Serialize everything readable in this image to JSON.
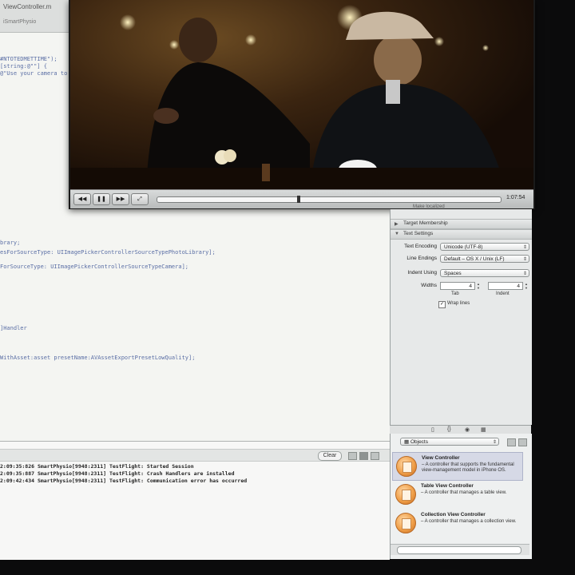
{
  "editor": {
    "tab_title": "ViewController.m",
    "tab_subtitle": "iSmartPhysio",
    "code_lines": [
      "#NTOTEDMETTIME\");",
      "[string:@\"\"] {",
      "@\"Use your camera to",
      "brary;",
      "esForSourceType: UIImagePickerControllerSourceTypePhotoLibrary];",
      "ForSourceType: UIImagePickerControllerSourceTypeCamera];",
      "]Handler",
      "WithAsset:asset presetName:AVAssetExportPresetLowQuality];"
    ]
  },
  "console": {
    "clear_label": "Clear",
    "log_lines": [
      "2:09:35:826 SmartPhysio[9948:2311] TestFlight: Started Session",
      "2:09:35:887 SmartPhysio[9948:2311] TestFlight: Crash Handlers are installed",
      "2:09:42:434 SmartPhysio[9948:2311] TestFlight: Communication error has occurred"
    ]
  },
  "video": {
    "rewind_icon": "rewind-icon",
    "play_icon": "pause-icon",
    "ffwd_icon": "fast-forward-icon",
    "fullscreen_icon": "fullscreen-icon",
    "time": "1:07:54",
    "progress": 0.41
  },
  "inspector": {
    "cropped_header": "Make localized",
    "target_membership": "Target Membership",
    "text_settings": "Text Settings",
    "text_encoding_label": "Text Encoding",
    "text_encoding_value": "Unicode (UTF-8)",
    "line_endings_label": "Line Endings",
    "line_endings_value": "Default – OS X / Unix (LF)",
    "indent_using_label": "Indent Using",
    "indent_using_value": "Spaces",
    "widths_label": "Widths",
    "tab_width": "4",
    "indent_width": "4",
    "tab_label": "Tab",
    "indent_label": "Indent",
    "wrap_lines_label": "Wrap lines",
    "wrap_lines_checked": true
  },
  "library": {
    "filter_value": "Objects",
    "items": [
      {
        "title": "View Controller",
        "desc": " – A controller that supports the fundamental view-management model in iPhone OS."
      },
      {
        "title": "Table View Controller",
        "desc": " – A controller that manages a table view."
      },
      {
        "title": "Collection View Controller",
        "desc": " – A controller that manages a collection view."
      }
    ]
  }
}
